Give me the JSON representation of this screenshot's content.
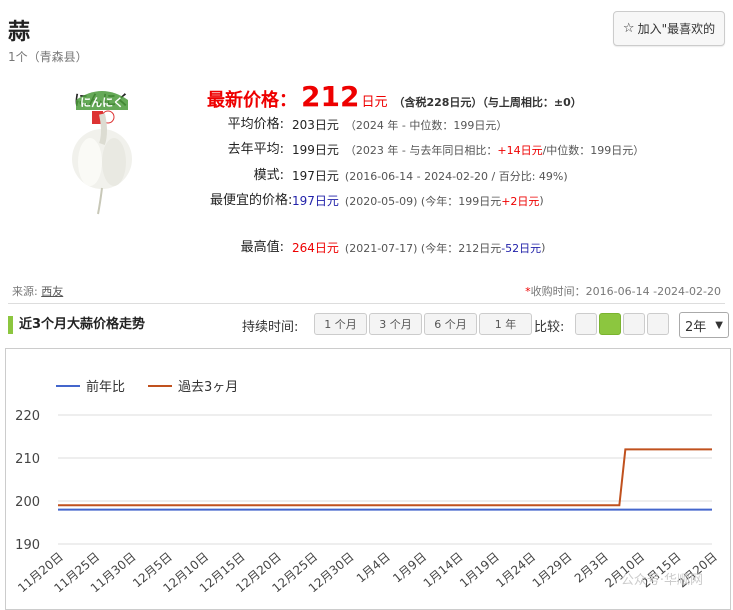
{
  "product": {
    "title": "蒜",
    "subtitle": "1个（青森县）",
    "favorite_label": "加入\"最喜欢的",
    "image_label": "にんにく"
  },
  "price": {
    "latest_label": "最新价格：",
    "latest_value": "212",
    "latest_unit": "日元",
    "latest_note": "（含税228日元）（与上周相比：±0）",
    "rows": [
      {
        "label": "平均价格:",
        "value": "203日元",
        "note_plain": "（2024 年 - 中位数：199日元）",
        "note_colored": "",
        "note_tail": ""
      },
      {
        "label": "去年平均:",
        "value": "199日元",
        "note_plain": "（2023 年 - 与去年同日相比：",
        "note_colored": "+14日元",
        "note_tail": "/中位数：199日元）"
      },
      {
        "label": "模式:",
        "value": "197日元",
        "note_plain": "(2016-06-14 - 2024-02-20 / 百分比: 49%)",
        "note_colored": "",
        "note_tail": ""
      },
      {
        "label": "最便宜的价格:",
        "value": "197日元",
        "note_plain": "(2020-05-09) (今年：199日元",
        "note_colored": "+2日元",
        "note_tail": ")"
      },
      {
        "label": "最高值:",
        "value": "264日元",
        "note_plain": "(2021-07-17) (今年：212日元",
        "note_colored": "-52日元",
        "note_tail": ")"
      }
    ]
  },
  "meta": {
    "source_label": "来源:",
    "source_link": "西友",
    "period_mark": "*",
    "period_text": "收购时间：2016-06-14 -2024-02-20"
  },
  "controls": {
    "section_title": "近3个月大蒜价格走势",
    "duration_label": "持续时间:",
    "duration_options": [
      "1 个月",
      "3 个月",
      "6 个月",
      "1 年"
    ],
    "compare_label": "比较:",
    "year_select": "2年"
  },
  "colors": {
    "accent_red": "#e00000",
    "accent_blue": "#2222aa",
    "accent_green": "#8cc63f",
    "series_prev": "#4466cc",
    "series_3m": "#c0511e"
  },
  "chart_data": {
    "type": "line",
    "x": [
      "11月20日",
      "11月25日",
      "11月30日",
      "12月5日",
      "12月10日",
      "12月15日",
      "12月20日",
      "12月25日",
      "12月30日",
      "1月4日",
      "1月9日",
      "1月14日",
      "1月19日",
      "1月24日",
      "1月29日",
      "2月3日",
      "2月10日",
      "2月15日",
      "2月20日"
    ],
    "series": [
      {
        "name": "前年比",
        "values": [
          198,
          198,
          198,
          198,
          198,
          198,
          198,
          198,
          198,
          198,
          198,
          198,
          198,
          198,
          198,
          198,
          198,
          198,
          198
        ]
      },
      {
        "name": "過去3ヶ月",
        "values": [
          199,
          199,
          199,
          199,
          199,
          199,
          199,
          199,
          199,
          199,
          199,
          199,
          199,
          199,
          199,
          199,
          212,
          212,
          212
        ]
      }
    ],
    "yticks": [
      190,
      200,
      210,
      220
    ],
    "ylim": [
      190,
      220
    ],
    "legend": "top-left",
    "grid": true
  },
  "watermark": "公众号·华顺网"
}
